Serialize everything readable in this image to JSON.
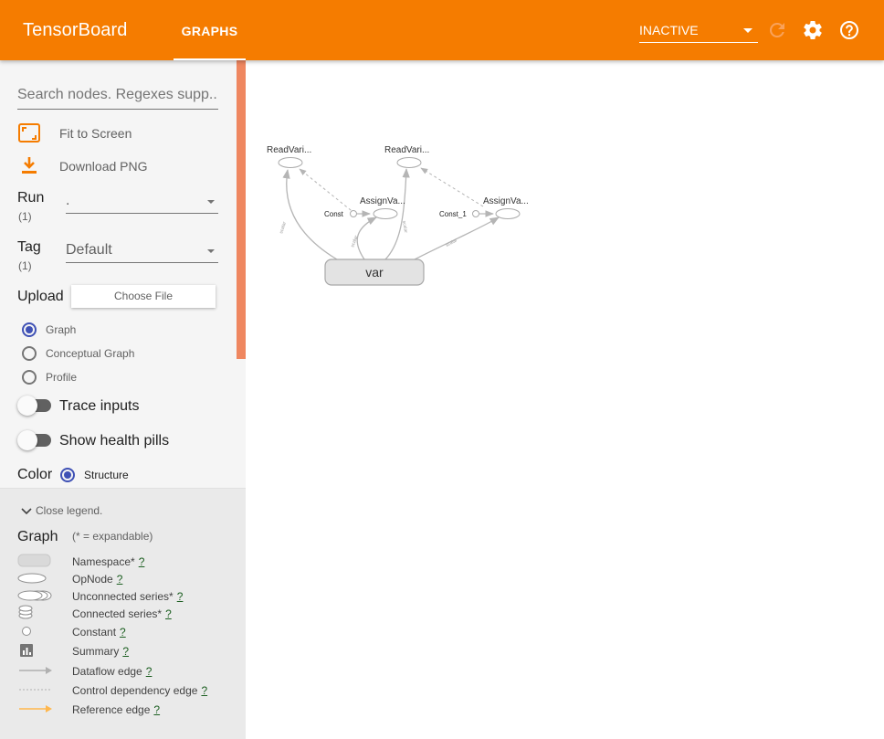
{
  "header": {
    "title": "TensorBoard",
    "active_tab": "GRAPHS",
    "status": "INACTIVE"
  },
  "sidebar": {
    "search_placeholder": "Search nodes. Regexes supp...",
    "fit_label": "Fit to Screen",
    "download_label": "Download PNG",
    "run_label": "Run",
    "run_count": "(1)",
    "run_value": ".",
    "tag_label": "Tag",
    "tag_count": "(1)",
    "tag_value": "Default",
    "upload_label": "Upload",
    "upload_button": "Choose File",
    "graph_types": [
      {
        "label": "Graph",
        "selected": true
      },
      {
        "label": "Conceptual Graph",
        "selected": false
      },
      {
        "label": "Profile",
        "selected": false
      }
    ],
    "trace_label": "Trace inputs",
    "health_label": "Show health pills",
    "color_label": "Color",
    "color_option": "Structure"
  },
  "legend": {
    "toggle": "Close legend.",
    "title": "Graph",
    "subtitle": "(* = expandable)",
    "help": "?",
    "items": [
      {
        "label": "Namespace*"
      },
      {
        "label": "OpNode"
      },
      {
        "label": "Unconnected series*"
      },
      {
        "label": "Connected series*"
      },
      {
        "label": "Constant"
      },
      {
        "label": "Summary"
      },
      {
        "label": "Dataflow edge"
      },
      {
        "label": "Control dependency edge"
      },
      {
        "label": "Reference edge"
      }
    ]
  },
  "graph": {
    "nodes": {
      "read1": "ReadVari...",
      "read2": "ReadVari...",
      "assign1": "AssignVa...",
      "assign2": "AssignVa...",
      "const1": "Const",
      "const2": "Const_1",
      "var": "var"
    },
    "edge_labels": {
      "e1": "scalar",
      "e2": "scalar",
      "e3": "scalar",
      "e4": "scalar"
    }
  },
  "colors": {
    "header": "#f57c00",
    "accent": "#3f51b5",
    "scrollbar": "#ef8760",
    "reference_edge": "#ffb74d"
  }
}
